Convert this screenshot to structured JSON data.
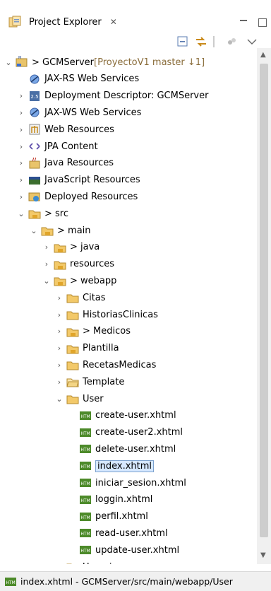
{
  "tab": {
    "title": "Project Explorer",
    "close": "✕"
  },
  "status": {
    "path": "index.xhtml - GCMServer/src/main/webapp/User"
  },
  "tree": [
    {
      "label": "> GCMServer",
      "deco": " [ProyectoV1 master ↓1]",
      "icon": "project-icon",
      "twisty": "down",
      "indent": 0
    },
    {
      "label": "JAX-RS Web Services",
      "icon": "webservice-icon",
      "twisty": "",
      "indent": 1
    },
    {
      "label": "Deployment Descriptor: GCMServer",
      "icon": "descriptor-icon",
      "twisty": "right",
      "indent": 1
    },
    {
      "label": "JAX-WS Web Services",
      "icon": "webservice-icon",
      "twisty": "right",
      "indent": 1
    },
    {
      "label": "Web Resources",
      "icon": "webresource-icon",
      "twisty": "right",
      "indent": 1
    },
    {
      "label": "JPA Content",
      "icon": "jpa-icon",
      "twisty": "right",
      "indent": 1
    },
    {
      "label": "Java Resources",
      "icon": "java-resources-icon",
      "twisty": "right",
      "indent": 1
    },
    {
      "label": "JavaScript Resources",
      "icon": "js-resources-icon",
      "twisty": "right",
      "indent": 1
    },
    {
      "label": "Deployed Resources",
      "icon": "deployed-icon",
      "twisty": "right",
      "indent": 1
    },
    {
      "label": "> src",
      "icon": "folder-git-icon",
      "twisty": "down",
      "indent": 1
    },
    {
      "label": "> main",
      "icon": "folder-git-icon",
      "twisty": "down",
      "indent": 2
    },
    {
      "label": "> java",
      "icon": "folder-git-icon",
      "twisty": "right",
      "indent": 3
    },
    {
      "label": "resources",
      "icon": "folder-git-icon",
      "twisty": "right",
      "indent": 3
    },
    {
      "label": "> webapp",
      "icon": "folder-git-icon",
      "twisty": "down",
      "indent": 3
    },
    {
      "label": "Citas",
      "icon": "folder-icon",
      "twisty": "right",
      "indent": 4
    },
    {
      "label": "HistoriasClinicas",
      "icon": "folder-icon",
      "twisty": "right",
      "indent": 4
    },
    {
      "label": "> Medicos",
      "icon": "folder-git-icon",
      "twisty": "right",
      "indent": 4
    },
    {
      "label": "Plantilla",
      "icon": "folder-git-icon",
      "twisty": "right",
      "indent": 4
    },
    {
      "label": "RecetasMedicas",
      "icon": "folder-icon",
      "twisty": "right",
      "indent": 4
    },
    {
      "label": "Template",
      "icon": "folder-open-icon",
      "twisty": "right",
      "indent": 4
    },
    {
      "label": "User",
      "icon": "folder-icon",
      "twisty": "down",
      "indent": 4
    },
    {
      "label": "create-user.xhtml",
      "icon": "xhtml-file-icon",
      "twisty": "",
      "indent": 5
    },
    {
      "label": "create-user2.xhtml",
      "icon": "xhtml-file-icon",
      "twisty": "",
      "indent": 5
    },
    {
      "label": "delete-user.xhtml",
      "icon": "xhtml-file-icon",
      "twisty": "",
      "indent": 5
    },
    {
      "label": "index.xhtml",
      "icon": "xhtml-file-icon",
      "twisty": "",
      "indent": 5,
      "selected": true
    },
    {
      "label": "iniciar_sesion.xhtml",
      "icon": "xhtml-file-icon",
      "twisty": "",
      "indent": 5
    },
    {
      "label": "loggin.xhtml",
      "icon": "xhtml-file-icon",
      "twisty": "",
      "indent": 5
    },
    {
      "label": "perfil.xhtml",
      "icon": "xhtml-file-icon",
      "twisty": "",
      "indent": 5
    },
    {
      "label": "read-user.xhtml",
      "icon": "xhtml-file-icon",
      "twisty": "",
      "indent": 5
    },
    {
      "label": "update-user.xhtml",
      "icon": "xhtml-file-icon",
      "twisty": "",
      "indent": 5
    },
    {
      "label": "Usuarios",
      "icon": "folder-icon",
      "twisty": "right",
      "indent": 4
    }
  ]
}
